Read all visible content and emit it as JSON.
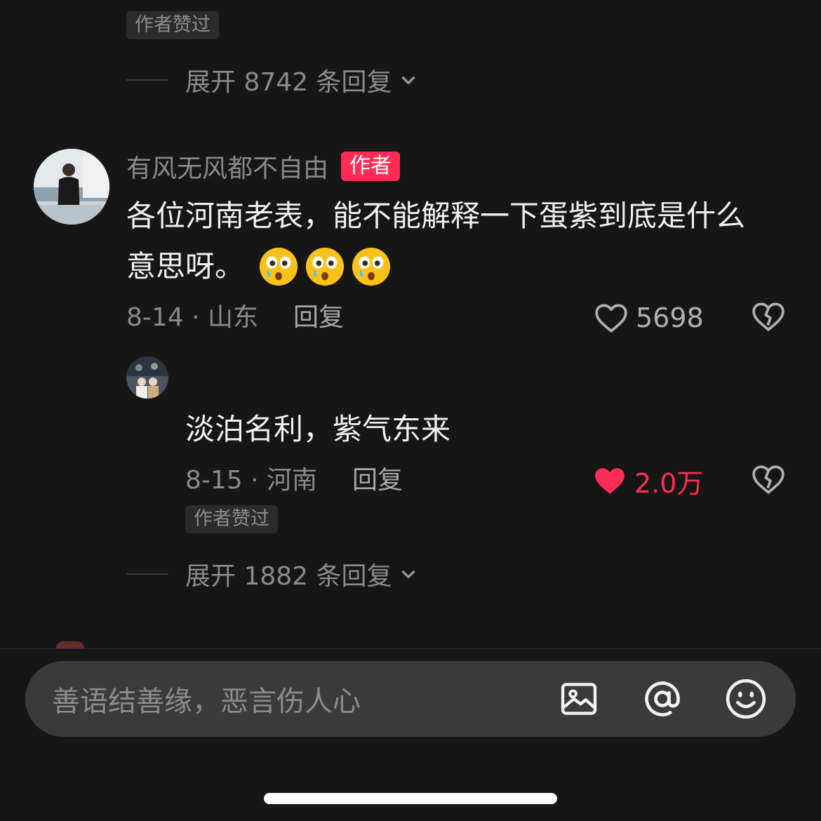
{
  "thread1": {
    "liked_badge": "作者赞过",
    "expand_text": "展开 8742 条回复"
  },
  "comment": {
    "username": "有风无风都不自由",
    "author_tag": "作者",
    "text_line1": "各位河南老表，能不能解释一下蛋紫到底是什么",
    "text_line2": "意思呀。",
    "emoji_count": 3,
    "date_location": "8-14 · 山东",
    "reply_label": "回复",
    "likes": "5698"
  },
  "reply": {
    "text": "淡泊名利，紫气东来",
    "date_location": "8-15 · 河南",
    "reply_label": "回复",
    "likes": "2.0万",
    "liked_badge": "作者赞过"
  },
  "thread2": {
    "expand_text": "展开 1882 条回复"
  },
  "input": {
    "placeholder": "善语结善缘，恶言伤人心"
  },
  "colors": {
    "background": "#161616",
    "accent": "#ff2c55",
    "input_bg": "#3a3a3a"
  }
}
